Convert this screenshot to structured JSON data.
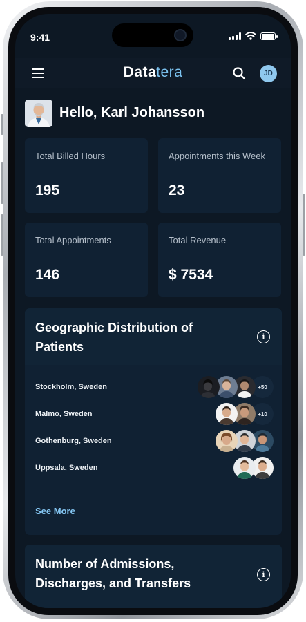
{
  "status_bar": {
    "time": "9:41"
  },
  "header": {
    "logo_part1": "Data",
    "logo_part2": "tera",
    "avatar_initials": "JD"
  },
  "greeting": {
    "text": "Hello, Karl Johansson"
  },
  "stats": [
    {
      "label": "Total Billed Hours",
      "value": "195"
    },
    {
      "label": "Appointments this Week",
      "value": "23"
    },
    {
      "label": "Total Appointments",
      "value": "146"
    },
    {
      "label": "Total Revenue",
      "value": "$ 7534"
    }
  ],
  "geo_card": {
    "title": "Geographic Distribution of Patients",
    "locations": [
      {
        "name": "Stockholm, Sweden",
        "more": "+50"
      },
      {
        "name": "Malmo, Sweden",
        "more": "+10"
      },
      {
        "name": "Gothenburg, Sweden",
        "more": ""
      },
      {
        "name": "Uppsala, Sweden",
        "more": ""
      }
    ],
    "see_more": "See More"
  },
  "admissions_card": {
    "title": "Number of Admissions, Discharges, and Transfers"
  },
  "colors": {
    "screen_bg": "#0d1824",
    "card_bg": "#102133",
    "accent": "#85c7f4",
    "avatar_bg": "#8fc8ee"
  },
  "icons": [
    "hamburger-icon",
    "search-icon",
    "info-icon",
    "signal-icon",
    "wifi-icon",
    "battery-icon"
  ]
}
